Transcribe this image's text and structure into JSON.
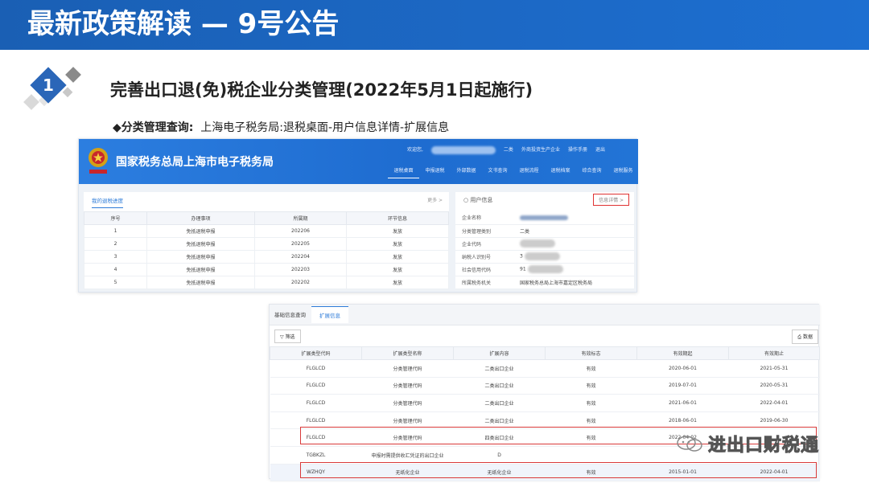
{
  "slide": {
    "title": "最新政策解读 — 9号公告",
    "number": "1",
    "heading": "完善出口退(免)税企业分类管理(2022年5月1日起施行)",
    "sub_label": "◆分类管理查询:",
    "sub_path": "上海电子税务局:退税桌面-用户信息详情-扩展信息"
  },
  "portal": {
    "site_name": "国家税务总局上海市电子税务局",
    "user_greeting": "欢迎您,",
    "user_class": "二类",
    "user_links": [
      "外商投资生产企业",
      "操作手册",
      "退出"
    ],
    "nav": [
      "退税桌面",
      "申报退税",
      "外部数据",
      "文书查询",
      "退税流程",
      "退税档案",
      "综合查询",
      "退税服务"
    ],
    "active_nav": 0,
    "progress": {
      "tab": "我的退税进度",
      "more": "更多 >",
      "columns": [
        "序号",
        "办理事项",
        "所属期",
        "环节信息"
      ],
      "rows": [
        [
          "1",
          "免抵退税申报",
          "202206",
          "发放"
        ],
        [
          "2",
          "免抵退税申报",
          "202205",
          "发放"
        ],
        [
          "3",
          "免抵退税申报",
          "202204",
          "发放"
        ],
        [
          "4",
          "免抵退税申报",
          "202203",
          "发放"
        ],
        [
          "5",
          "免抵退税申报",
          "202202",
          "发放"
        ]
      ]
    },
    "user_info": {
      "title": "用户信息",
      "details_link": "信息详情 >",
      "rows": [
        {
          "k": "企业名称",
          "v": ""
        },
        {
          "k": "分类管理类别",
          "v": "二类"
        },
        {
          "k": "企业代码",
          "v": ""
        },
        {
          "k": "纳税人识别号",
          "v": "3"
        },
        {
          "k": "社会信用代码",
          "v": "91"
        },
        {
          "k": "所属税务机关",
          "v": "国家税务总局上海市嘉定区税务局"
        }
      ]
    }
  },
  "extension": {
    "tabs": [
      "基础信息查询",
      "扩展信息"
    ],
    "active_tab": 1,
    "filter_label": "筛选",
    "print_label": "数据",
    "columns": [
      "扩展类型代码",
      "扩展类型名称",
      "扩展内容",
      "有效标志",
      "有效期起",
      "有效期止"
    ],
    "rows": [
      [
        "FLGLCD",
        "分类管理代码",
        "二类出口企业",
        "有效",
        "2020-06-01",
        "2021-05-31"
      ],
      [
        "FLGLCD",
        "分类管理代码",
        "二类出口企业",
        "有效",
        "2019-07-01",
        "2020-05-31"
      ],
      [
        "FLGLCD",
        "分类管理代码",
        "二类出口企业",
        "有效",
        "2021-06-01",
        "2022-04-01"
      ],
      [
        "FLGLCD",
        "分类管理代码",
        "二类出口企业",
        "有效",
        "2018-06-01",
        "2019-06-30"
      ],
      [
        "FLGLCD",
        "分类管理代码",
        "四类出口企业",
        "有效",
        "2022-04-02",
        ""
      ],
      [
        "TGBKZL",
        "申报时需提供收汇凭证的出口企业",
        "D",
        "",
        "",
        ""
      ],
      [
        "WZHQY",
        "无纸化企业",
        "无纸化企业",
        "有效",
        "2015-01-01",
        "2022-04-01"
      ]
    ]
  },
  "watermark": "进出口财税通",
  "colors": {
    "banner": "#1d6fd1",
    "highlight": "#d93a3a",
    "link": "#2d7bd8"
  }
}
